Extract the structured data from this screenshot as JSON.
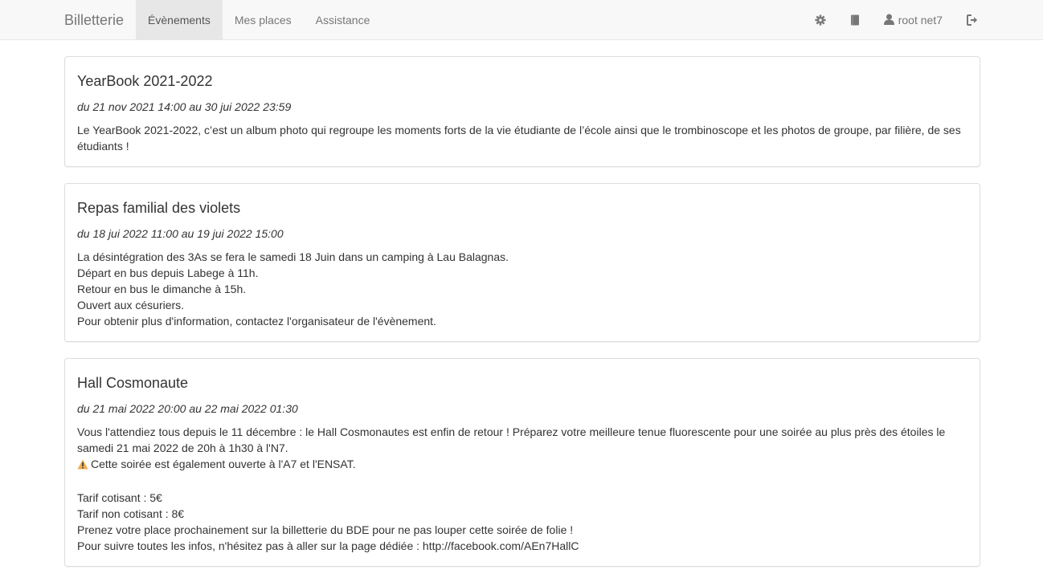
{
  "navbar": {
    "brand": "Billetterie",
    "items": [
      {
        "label": "Évènements",
        "active": true
      },
      {
        "label": "Mes places",
        "active": false
      },
      {
        "label": "Assistance",
        "active": false
      }
    ],
    "icons": [
      "gear-icon",
      "book-icon",
      "user-icon",
      "logout-icon"
    ],
    "user_name": "root net7"
  },
  "events": [
    {
      "title": "YearBook 2021-2022",
      "dates": "du 21 nov 2021 14:00 au 30 jui 2022 23:59",
      "lines": [
        "Le YearBook 2021-2022, c’est un album photo qui regroupe les moments forts de la vie étudiante de l’école ainsi que le trombinoscope et les photos de groupe, par filière, de ses étudiants !"
      ]
    },
    {
      "title": "Repas familial des violets",
      "dates": "du 18 jui 2022 11:00 au 19 jui 2022 15:00",
      "lines": [
        "La désintégration des 3As se fera le samedi 18 Juin dans un camping à Lau Balagnas.",
        "Départ en bus depuis Labege à 11h.",
        "Retour en bus le dimanche à 15h.",
        "Ouvert aux césuriers.",
        "Pour obtenir plus d'information, contactez l'organisateur de l'évènement."
      ]
    },
    {
      "title": "Hall Cosmonaute",
      "dates": "du 21 mai 2022 20:00 au 22 mai 2022 01:30",
      "lines": [
        "Vous l'attendiez tous depuis le 11 décembre : le Hall Cosmonautes est enfin de retour ! Préparez votre meilleure tenue fluorescente pour une soirée au plus près des étoiles le samedi 21 mai 2022 de 20h à 1h30 à l'N7.",
        "Cette soirée est également ouverte à l'A7 et l'ENSAT.",
        "",
        "Tarif cotisant : 5€",
        "Tarif non cotisant : 8€",
        "Prenez votre place prochainement sur la billetterie du BDE pour ne pas louper cette soirée de folie !",
        "Pour suivre toutes les infos, n'hésitez pas à aller sur la page dédiée : http://facebook.com/AEn7HallC"
      ],
      "warning_icon": "warning-icon"
    }
  ],
  "colors": {
    "navbar_bg": "#f8f8f8",
    "active_bg": "#e7e7e7",
    "nav_text": "#777777",
    "panel_border": "#dddddd",
    "warning": "#f0ad4e"
  }
}
